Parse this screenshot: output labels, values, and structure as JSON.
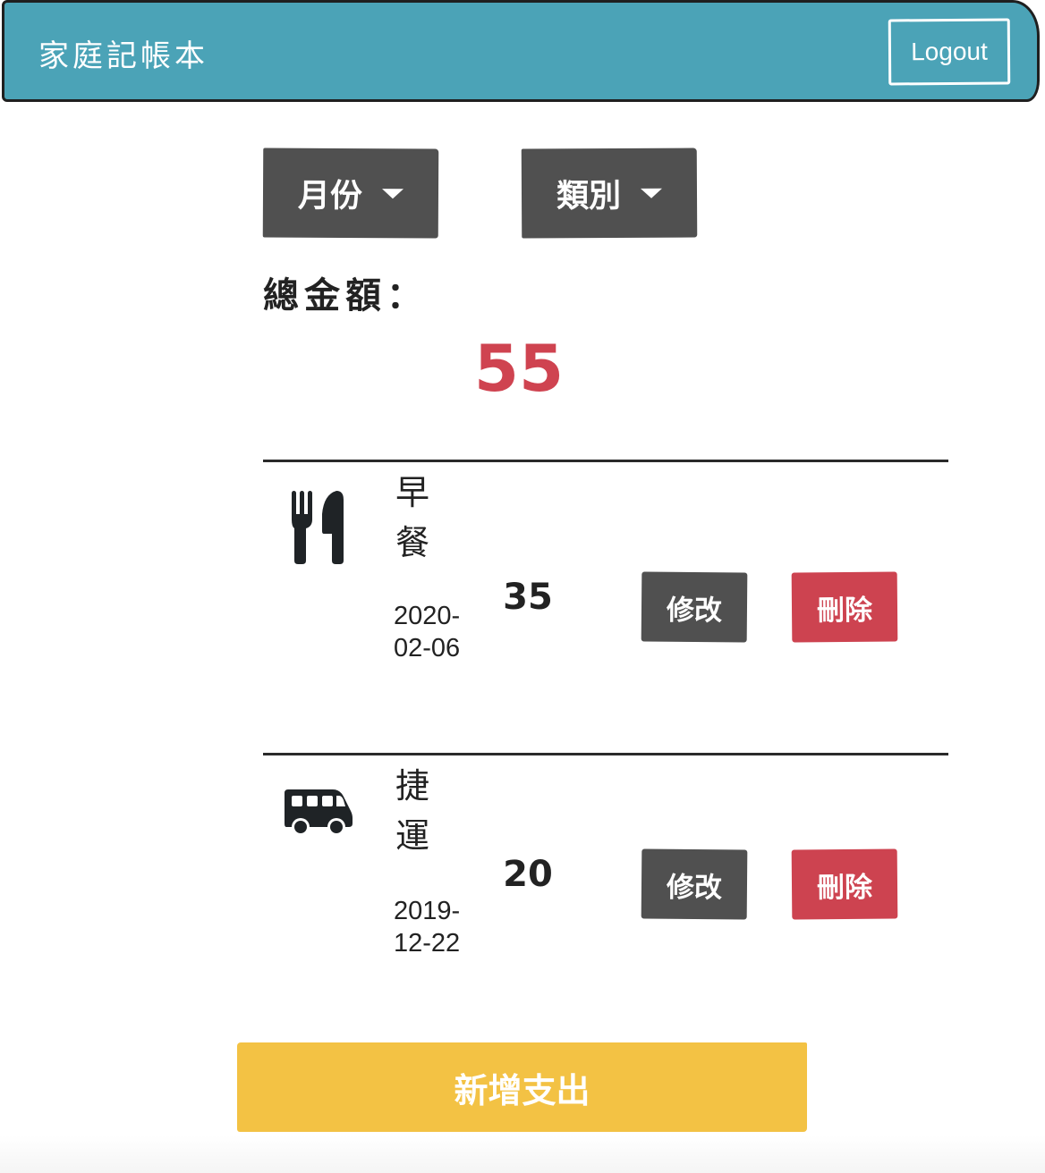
{
  "header": {
    "brand": "家庭記帳本",
    "logout_label": "Logout"
  },
  "filters": {
    "month_label": "月份",
    "category_label": "類別"
  },
  "summary": {
    "total_label": "總金額：",
    "total_value": "55"
  },
  "expenses": [
    {
      "icon": "utensils-icon",
      "name": "早餐",
      "date": "2020-02-06",
      "amount": "35",
      "edit_label": "修改",
      "delete_label": "刪除"
    },
    {
      "icon": "bus-icon",
      "name": "捷運",
      "date": "2019-12-22",
      "amount": "20",
      "edit_label": "修改",
      "delete_label": "刪除"
    }
  ],
  "actions": {
    "add_label": "新增支出"
  },
  "colors": {
    "navbar": "#4ba3b7",
    "dark_button": "#505050",
    "danger": "#cd4350",
    "total": "#cf4350",
    "add_button": "#f3c244"
  }
}
